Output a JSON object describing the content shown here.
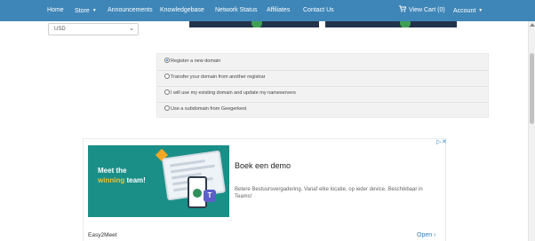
{
  "nav": {
    "items": [
      "Home",
      "Store",
      "Announcements",
      "Knowledgebase",
      "Network Status",
      "Affiliates",
      "Contact Us"
    ],
    "cart_label": "View Cart (0)",
    "account_label": "Account",
    "color": "#3f86b8"
  },
  "currency": {
    "selected": "USD"
  },
  "domain_options": [
    "Register a new domain",
    "Transfer your domain from another registrar",
    "I will use my existing domain and update my nameservers",
    "Use a subdomain from Geegerkest"
  ],
  "ad": {
    "image_line1": "Meet the",
    "image_line2_hl": "winning",
    "image_line2_rest": "team!",
    "headline": "Boek een demo",
    "body": "Betere Bestuursvergadering. Vanaf elke locatie, op ieder device. Beschikbaar in Teams!",
    "advertiser": "Easy2Meet",
    "open_label": "Open",
    "image_bg_color": "#1a8f88",
    "highlight_color": "#f2c230",
    "link_color": "#2b7fc6"
  }
}
